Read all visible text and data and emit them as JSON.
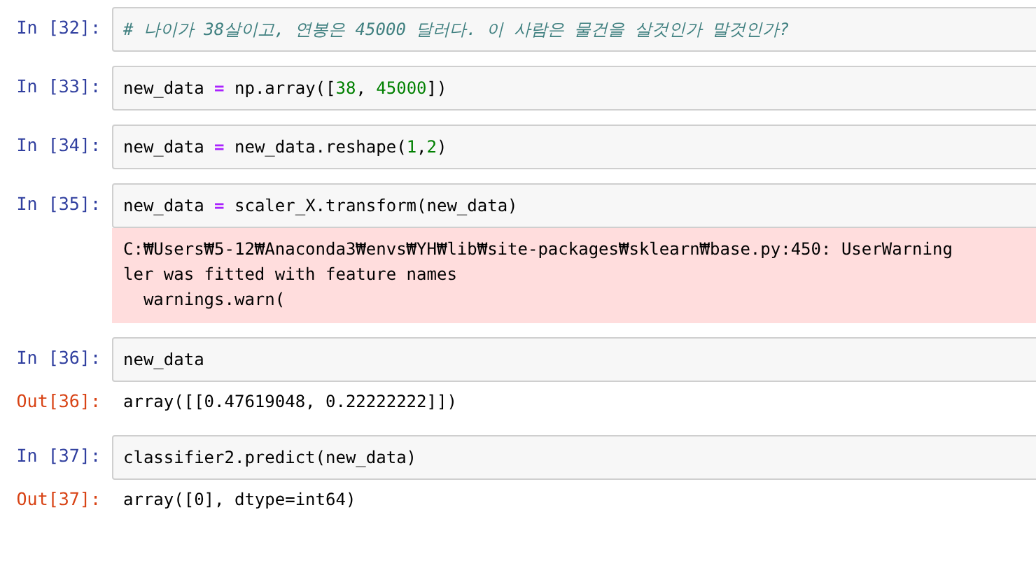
{
  "cells": [
    {
      "prompt": "In [32]:",
      "code": [
        {
          "kind": "comment",
          "text": "# 나이가 38살이고, 연봉은 45000 달러다. 이 사람은 물건을 살것인가 말것인가?"
        }
      ]
    },
    {
      "prompt": "In [33]:",
      "code": [
        {
          "kind": "plain",
          "text": "new_data "
        },
        {
          "kind": "op",
          "text": "="
        },
        {
          "kind": "plain",
          "text": " np.array(["
        },
        {
          "kind": "num",
          "text": "38"
        },
        {
          "kind": "plain",
          "text": ", "
        },
        {
          "kind": "num",
          "text": "45000"
        },
        {
          "kind": "plain",
          "text": "])"
        }
      ]
    },
    {
      "prompt": "In [34]:",
      "code": [
        {
          "kind": "plain",
          "text": "new_data "
        },
        {
          "kind": "op",
          "text": "="
        },
        {
          "kind": "plain",
          "text": " new_data.reshape("
        },
        {
          "kind": "num",
          "text": "1"
        },
        {
          "kind": "plain",
          "text": ","
        },
        {
          "kind": "num",
          "text": "2"
        },
        {
          "kind": "plain",
          "text": ")"
        }
      ]
    },
    {
      "prompt": "In [35]:",
      "code": [
        {
          "kind": "plain",
          "text": "new_data "
        },
        {
          "kind": "op",
          "text": "="
        },
        {
          "kind": "plain",
          "text": " scaler_X.transform(new_data)"
        }
      ],
      "output": {
        "kind": "stderr",
        "lines": [
          "C:₩Users₩5-12₩Anaconda3₩envs₩YH₩lib₩site-packages₩sklearn₩base.py:450: UserWarning",
          "ler was fitted with feature names",
          "  warnings.warn("
        ]
      }
    },
    {
      "prompt": "In [36]:",
      "code": [
        {
          "kind": "plain",
          "text": "new_data"
        }
      ],
      "output": {
        "kind": "result",
        "prompt": "Out[36]:",
        "lines": [
          "array([[0.47619048, 0.22222222]])"
        ]
      }
    },
    {
      "prompt": "In [37]:",
      "code": [
        {
          "kind": "plain",
          "text": "classifier2.predict(new_data)"
        }
      ],
      "output": {
        "kind": "result",
        "prompt": "Out[37]:",
        "lines": [
          "array([0], dtype=int64)"
        ]
      }
    }
  ]
}
